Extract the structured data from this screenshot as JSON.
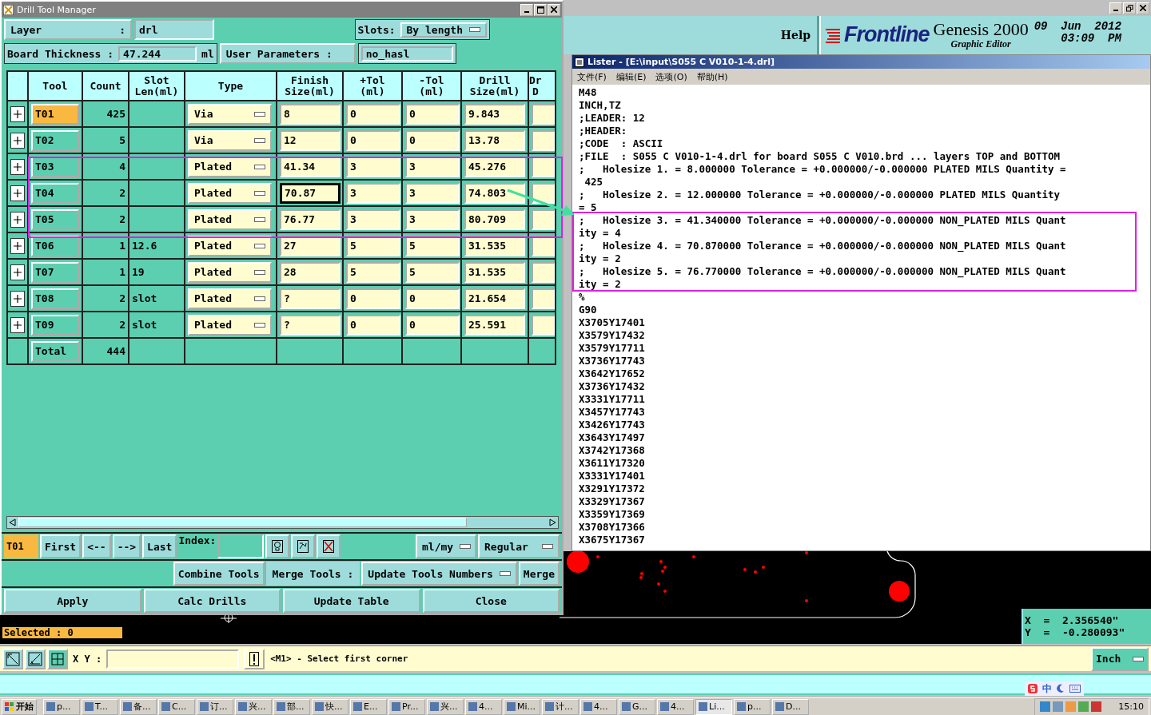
{
  "drill_window": {
    "title": "Drill Tool Manager",
    "layer_label": "Layer",
    "layer_colon": ":",
    "layer_value": "drl",
    "slots_label": "Slots:",
    "slots_value": "By length",
    "thickness_label": "Board Thickness :",
    "thickness_value": "47.244",
    "thickness_unit": "ml",
    "user_params_label": "User Parameters :",
    "user_params_value": "no_hasl",
    "columns": [
      [
        "Tool"
      ],
      [
        "Count"
      ],
      [
        "Slot",
        "Len(ml)"
      ],
      [
        "Type"
      ],
      [
        "Finish",
        "Size(ml)"
      ],
      [
        "+Tol",
        "(ml)"
      ],
      [
        "-Tol",
        "(ml)"
      ],
      [
        "Drill",
        "Size(ml)"
      ],
      [
        "Dr",
        "D"
      ]
    ],
    "rows": [
      {
        "tool": "T01",
        "selected": true,
        "count": "425",
        "type": "Via",
        "finish": "8",
        "finish_focused": false,
        "plus_tol": "0",
        "minus_tol": "0",
        "drill": "9.843"
      },
      {
        "tool": "T02",
        "selected": false,
        "count": "5",
        "type": "Via",
        "finish": "12",
        "finish_focused": false,
        "plus_tol": "0",
        "minus_tol": "0",
        "drill": "13.78"
      },
      {
        "tool": "T03",
        "selected": false,
        "count": "4",
        "type": "Plated",
        "finish": "41.34",
        "finish_focused": false,
        "plus_tol": "3",
        "minus_tol": "3",
        "drill": "45.276"
      },
      {
        "tool": "T04",
        "selected": false,
        "count": "2",
        "type": "Plated",
        "finish": "70.87",
        "finish_focused": true,
        "plus_tol": "3",
        "minus_tol": "3",
        "drill": "74.803"
      },
      {
        "tool": "T05",
        "selected": false,
        "count": "2",
        "type": "Plated",
        "finish": "76.77",
        "finish_focused": false,
        "plus_tol": "3",
        "minus_tol": "3",
        "drill": "80.709"
      },
      {
        "tool": "T06",
        "selected": false,
        "count": "1",
        "slot_len": "12.6",
        "type": "Plated",
        "finish": "27",
        "finish_focused": false,
        "plus_tol": "5",
        "minus_tol": "5",
        "drill": "31.535"
      },
      {
        "tool": "T07",
        "selected": false,
        "count": "1",
        "slot_len": "19",
        "type": "Plated",
        "finish": "28",
        "finish_focused": false,
        "plus_tol": "5",
        "minus_tol": "5",
        "drill": "31.535"
      },
      {
        "tool": "T08",
        "selected": false,
        "count": "2",
        "slot_len": "slot",
        "type": "Plated",
        "finish": "?",
        "finish_focused": false,
        "plus_tol": "0",
        "minus_tol": "0",
        "drill": "21.654"
      },
      {
        "tool": "T09",
        "selected": false,
        "count": "2",
        "slot_len": "slot",
        "type": "Plated",
        "finish": "?",
        "finish_focused": false,
        "plus_tol": "0",
        "minus_tol": "0",
        "drill": "25.591"
      }
    ],
    "total": {
      "label": "Total",
      "count": "444"
    },
    "nav": {
      "current": "T01",
      "buttons": [
        "First",
        "<--",
        "-->",
        "Last"
      ],
      "index_label": "Index:",
      "units": "ml/my",
      "mode": "Regular"
    },
    "actions": {
      "combine": "Combine Tools",
      "merge_label": "Merge Tools :",
      "merge_mode": "Update Tools Numbers",
      "merge": "Merge",
      "buttons": [
        "Apply",
        "Calc Drills",
        "Update Table",
        "Close"
      ]
    }
  },
  "app": {
    "help": "Help",
    "logo": "Frontline",
    "product": "Genesis 2000",
    "subtitle": "Graphic Editor",
    "date": "09  Jun  2012",
    "time": "03:09  PM",
    "selected": "Selected : 0",
    "coord_x": "X  =  2.356540\"",
    "coord_y": "Y  =  -0.280093\"",
    "xy_label": "X Y :",
    "prompt": "<M1> - Select first corner",
    "unit": "Inch"
  },
  "lister": {
    "title": "Lister - [E:\\input\\S055 C V010-1-4.drl]",
    "menu": [
      "文件(F)",
      "编辑(E)",
      "选项(O)",
      "帮助(H)"
    ],
    "lines": [
      "M48",
      "INCH,TZ",
      ";LEADER: 12",
      ";HEADER:",
      ";CODE  : ASCII",
      ";FILE  : S055 C V010-1-4.drl for board S055 C V010.brd ... layers TOP and BOTTOM",
      ";   Holesize 1. = 8.000000 Tolerance = +0.000000/-0.000000 PLATED MILS Quantity =",
      " 425",
      ";   Holesize 2. = 12.000000 Tolerance = +0.000000/-0.000000 PLATED MILS Quantity",
      "= 5",
      ";   Holesize 3. = 41.340000 Tolerance = +0.000000/-0.000000 NON_PLATED MILS Quant",
      "ity = 4",
      ";   Holesize 4. = 70.870000 Tolerance = +0.000000/-0.000000 NON_PLATED MILS Quant",
      "ity = 2",
      ";   Holesize 5. = 76.770000 Tolerance = +0.000000/-0.000000 NON_PLATED MILS Quant",
      "ity = 2",
      "%",
      "G90",
      "X3705Y17401",
      "X3579Y17432",
      "X3579Y17711",
      "X3736Y17743",
      "X3642Y17652",
      "X3736Y17432",
      "X3331Y17711",
      "X3457Y17743",
      "X3426Y17743",
      "X3643Y17497",
      "X3742Y17368",
      "X3611Y17320",
      "X3331Y17401",
      "X3291Y17372",
      "X3329Y17367",
      "X3359Y17369",
      "X3708Y17366",
      "X3675Y17367"
    ]
  },
  "taskbar": {
    "start": "开始",
    "items": [
      {
        "label": "p...",
        "selected": false
      },
      {
        "label": "T...",
        "selected": false
      },
      {
        "label": "备...",
        "selected": false
      },
      {
        "label": "C...",
        "selected": false
      },
      {
        "label": "订...",
        "selected": false
      },
      {
        "label": "兴...",
        "selected": false
      },
      {
        "label": "部...",
        "selected": false
      },
      {
        "label": "快...",
        "selected": false
      },
      {
        "label": "E...",
        "selected": false
      },
      {
        "label": "Pr...",
        "selected": false
      },
      {
        "label": "兴...",
        "selected": false
      },
      {
        "label": "4...",
        "selected": false
      },
      {
        "label": "Mi...",
        "selected": false
      },
      {
        "label": "计...",
        "selected": false
      },
      {
        "label": "4...",
        "selected": false
      },
      {
        "label": "G...",
        "selected": false
      },
      {
        "label": "4...",
        "selected": false
      },
      {
        "label": "Li...",
        "selected": true
      },
      {
        "label": "p...",
        "selected": false
      },
      {
        "label": "D...",
        "selected": false
      }
    ],
    "ime": "中",
    "clock": "15:10"
  }
}
